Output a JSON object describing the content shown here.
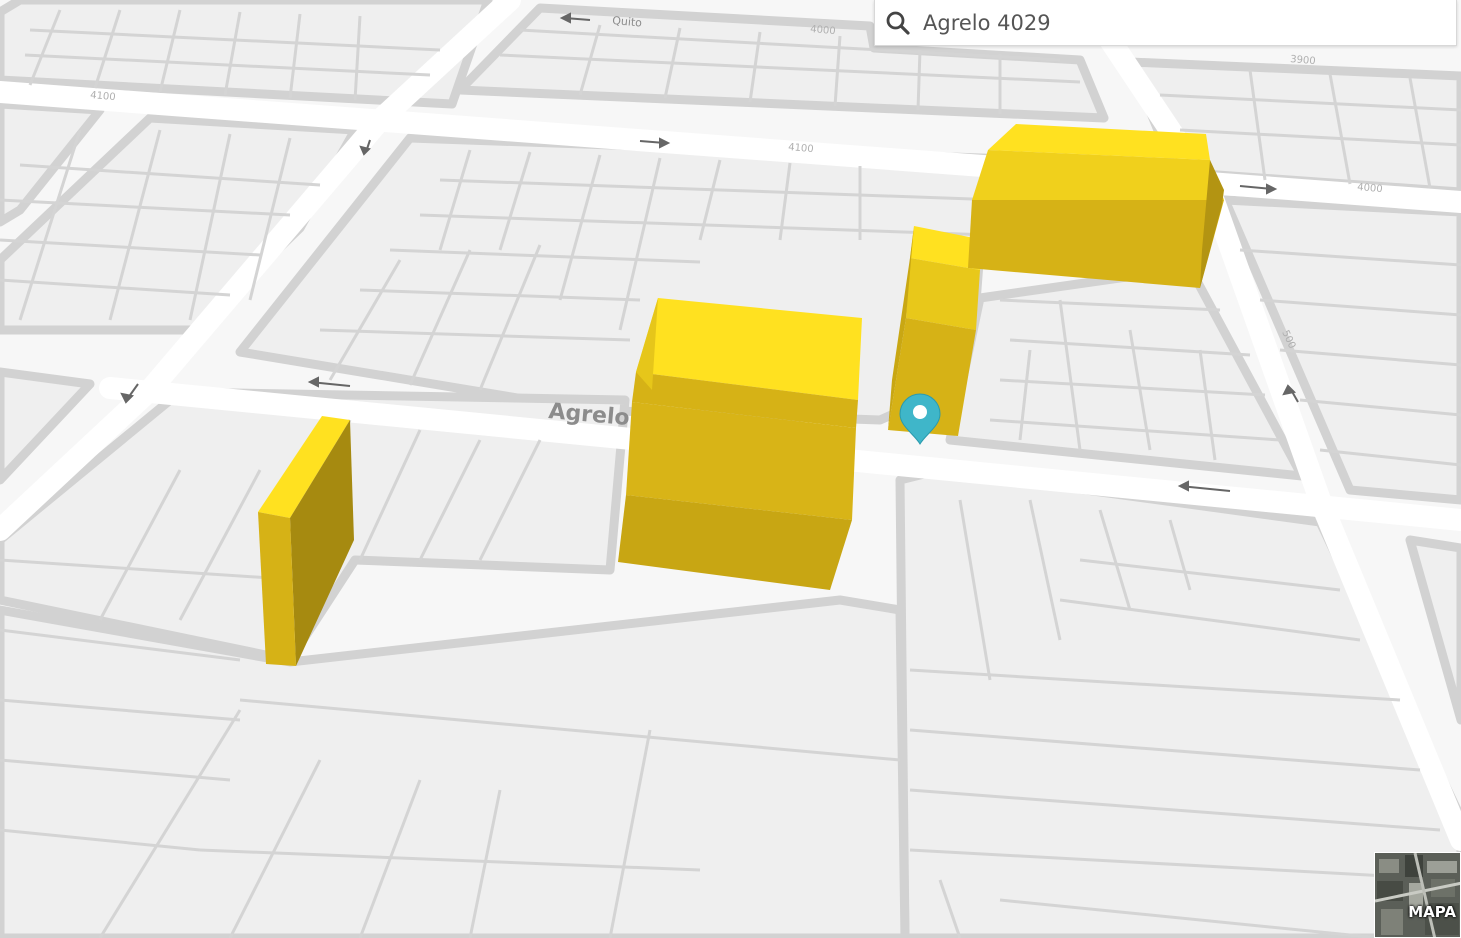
{
  "map": {
    "street_label": "Agrelo",
    "street_label_top": "Quito",
    "house_numbers": [
      "4100",
      "4100",
      "4000",
      "4000",
      "500",
      "3900"
    ]
  },
  "search": {
    "value": "Agrelo 4029",
    "icon": "search-icon"
  },
  "marker": {
    "icon": "map-pin-icon",
    "color": "#3fb6c9"
  },
  "layer_toggle": {
    "label": "MAPA",
    "icon": "satellite-thumbnail"
  },
  "colors": {
    "building_front": "#d6b216",
    "building_side": "#a68a10",
    "building_top": "#ffe120",
    "road": "#ffffff",
    "block": "#efefef",
    "curb": "#d2d2d2"
  }
}
